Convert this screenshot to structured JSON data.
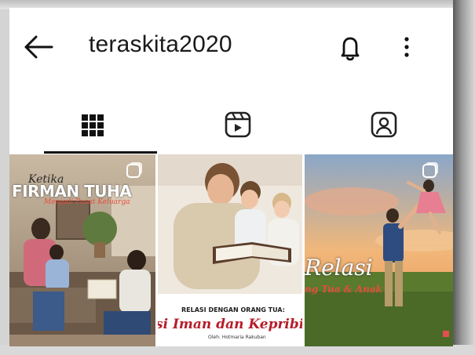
{
  "header": {
    "username": "teraskita2020",
    "icons": {
      "back": "arrow-left-icon",
      "notifications": "bell-icon",
      "more": "more-vertical-icon"
    }
  },
  "tabs": [
    {
      "id": "grid",
      "icon": "grid-icon",
      "active": true
    },
    {
      "id": "reels",
      "icon": "reels-icon",
      "active": false
    },
    {
      "id": "tagged",
      "icon": "tagged-person-icon",
      "active": false
    }
  ],
  "posts": [
    {
      "script_text": "Ketika",
      "title": "FIRMAN TUHA",
      "subtitle": "Menjadi Pusat Keluarga",
      "multi": true
    },
    {
      "caption": "RELASI DENGAN ORANG TUA:",
      "title": "si Iman dan Kepribi",
      "author": "Oleh: Hotmaria Rakuban",
      "multi": false
    },
    {
      "title": "Relasi",
      "subtitle": "ng Tua & Anak",
      "multi": true
    }
  ],
  "colors": {
    "accent_red": "#e74c3c",
    "text_dark": "#1a1a1a",
    "background": "#ffffff"
  }
}
